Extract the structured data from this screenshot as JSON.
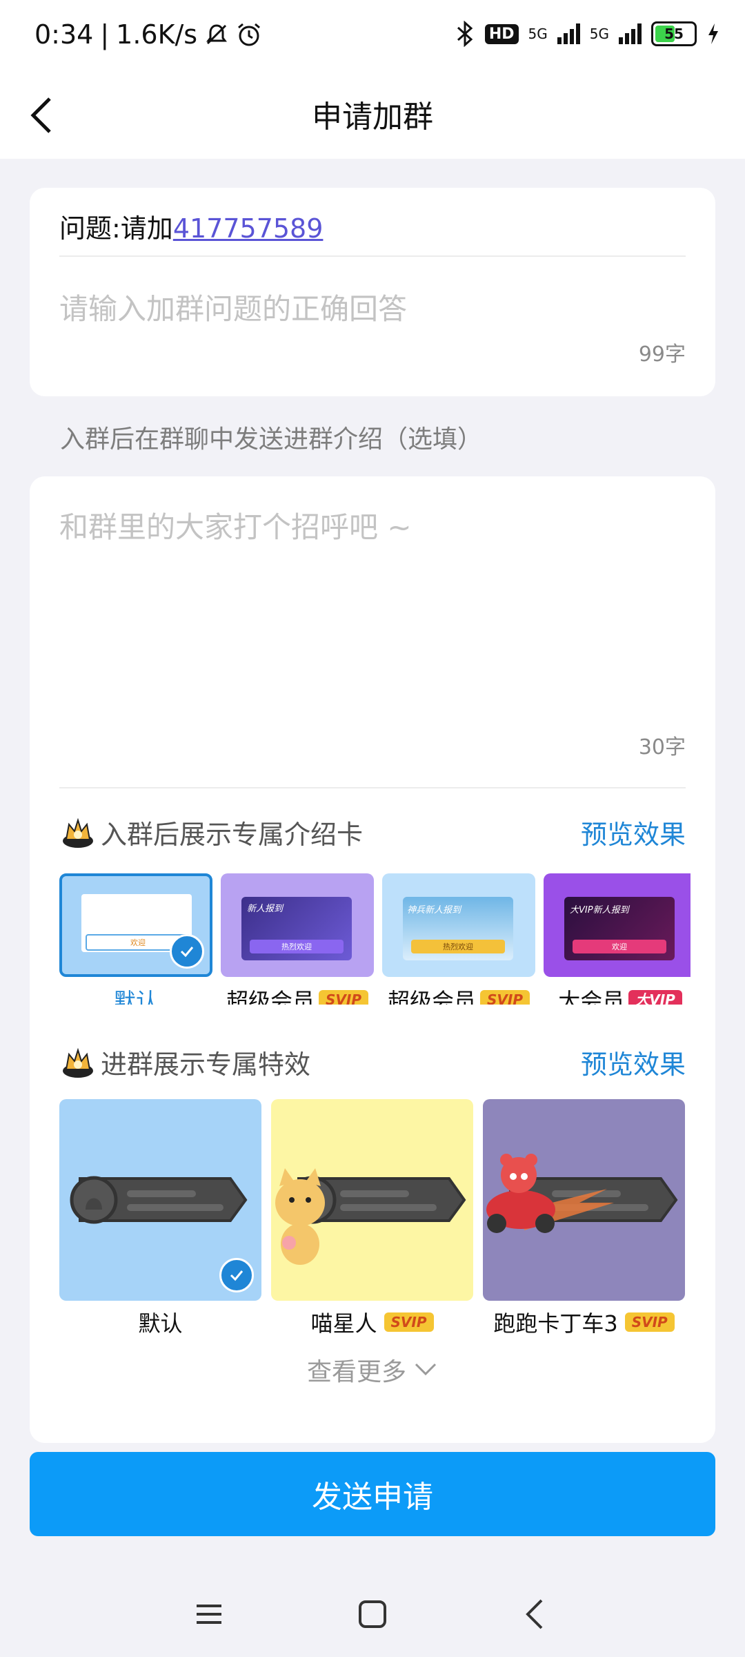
{
  "status_bar": {
    "time": "0:34",
    "network_speed": "1.6K/s",
    "network_1": "5G",
    "network_2": "5G",
    "hd": "HD",
    "battery": "55",
    "icons": [
      "mute-icon",
      "alarm-icon",
      "bluetooth-icon",
      "signal-icon",
      "charging-icon"
    ]
  },
  "header": {
    "title": "申请加群",
    "back_icon": "back-arrow-icon"
  },
  "question_card": {
    "question_prefix": "问题:请加",
    "question_link": "417757589",
    "answer_placeholder": "请输入加群问题的正确回答",
    "answer_counter": "99字"
  },
  "intro_hint": "入群后在群聊中发送进群介绍（选填）",
  "intro_card": {
    "placeholder": "和群里的大家打个招呼吧 ~",
    "counter": "30字"
  },
  "intro_cards_section": {
    "title": "入群后展示专属介绍卡",
    "preview": "预览效果",
    "items": [
      {
        "label": "默认",
        "badge": "",
        "selected": true,
        "button_text": "欢迎"
      },
      {
        "label": "超级会员",
        "badge": "SVIP",
        "selected": false,
        "banner": "新人报到",
        "button_text": "热烈欢迎"
      },
      {
        "label": "超级会员",
        "badge": "SVIP",
        "selected": false,
        "banner": "神兵新人报到",
        "button_text": "热烈欢迎"
      },
      {
        "label": "大会员",
        "badge": "大VIP",
        "selected": false,
        "banner": "大VIP新人报到",
        "button_text": "欢迎"
      }
    ]
  },
  "effects_section": {
    "title": "进群展示专属特效",
    "preview": "预览效果",
    "items": [
      {
        "label": "默认",
        "badge": "",
        "selected": true,
        "color": "#a6d3f8"
      },
      {
        "label": "喵星人",
        "badge": "SVIP",
        "selected": false,
        "color": "#fdf6a4"
      },
      {
        "label": "跑跑卡丁车3",
        "badge": "SVIP",
        "selected": false,
        "color": "#8e86bb"
      }
    ],
    "see_more": "查看更多"
  },
  "send_button": "发送申请",
  "bottom_nav": [
    "menu-icon",
    "home-icon",
    "back-icon"
  ],
  "colors": {
    "accent": "#0c9bf8",
    "link": "#5a54d6",
    "preview": "#1f86d6",
    "background": "#f2f2f7"
  }
}
